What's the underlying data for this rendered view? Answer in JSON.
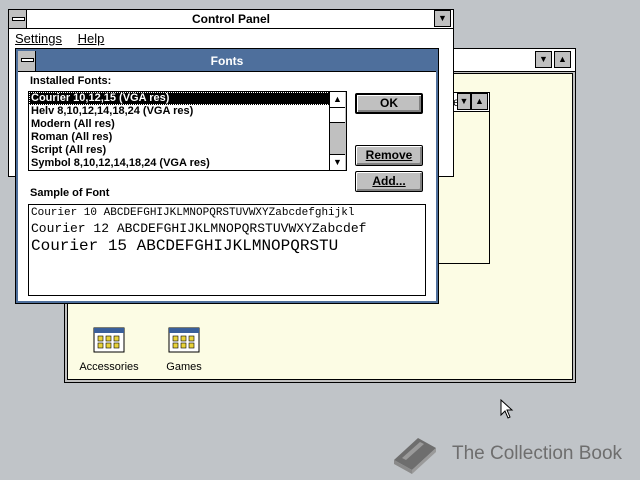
{
  "control_panel": {
    "title": "Control Panel",
    "menu": [
      "Settings",
      "Help"
    ]
  },
  "program_manager": {
    "partial_label": "ed"
  },
  "program_groups": [
    {
      "label": "Accessories"
    },
    {
      "label": "Games"
    }
  ],
  "fonts_dialog": {
    "title": "Fonts",
    "installed_label": "Installed Fonts:",
    "fonts": [
      "Courier 10,12,15 (VGA res)",
      "Helv 8,10,12,14,18,24 (VGA res)",
      "Modern (All res)",
      "Roman (All res)",
      "Script (All res)",
      "Symbol 8,10,12,14,18,24 (VGA res)"
    ],
    "selected_index": 0,
    "buttons": {
      "ok": "OK",
      "remove": "Remove",
      "add": "Add..."
    },
    "sample_label": "Sample of Font",
    "samples": [
      "Courier 10  ABCDEFGHIJKLMNOPQRSTUVWXYZabcdefghijkl",
      "Courier 12  ABCDEFGHIJKLMNOPQRSTUVWXYZabcdef",
      "Courier 15  ABCDEFGHIJKLMNOPQRSTU"
    ]
  },
  "watermark": {
    "text": "The Collection Book"
  },
  "colors": {
    "active_title": "#4e6f9c",
    "desktop": "#c0c4c8",
    "workspace": "#fcfce4"
  }
}
